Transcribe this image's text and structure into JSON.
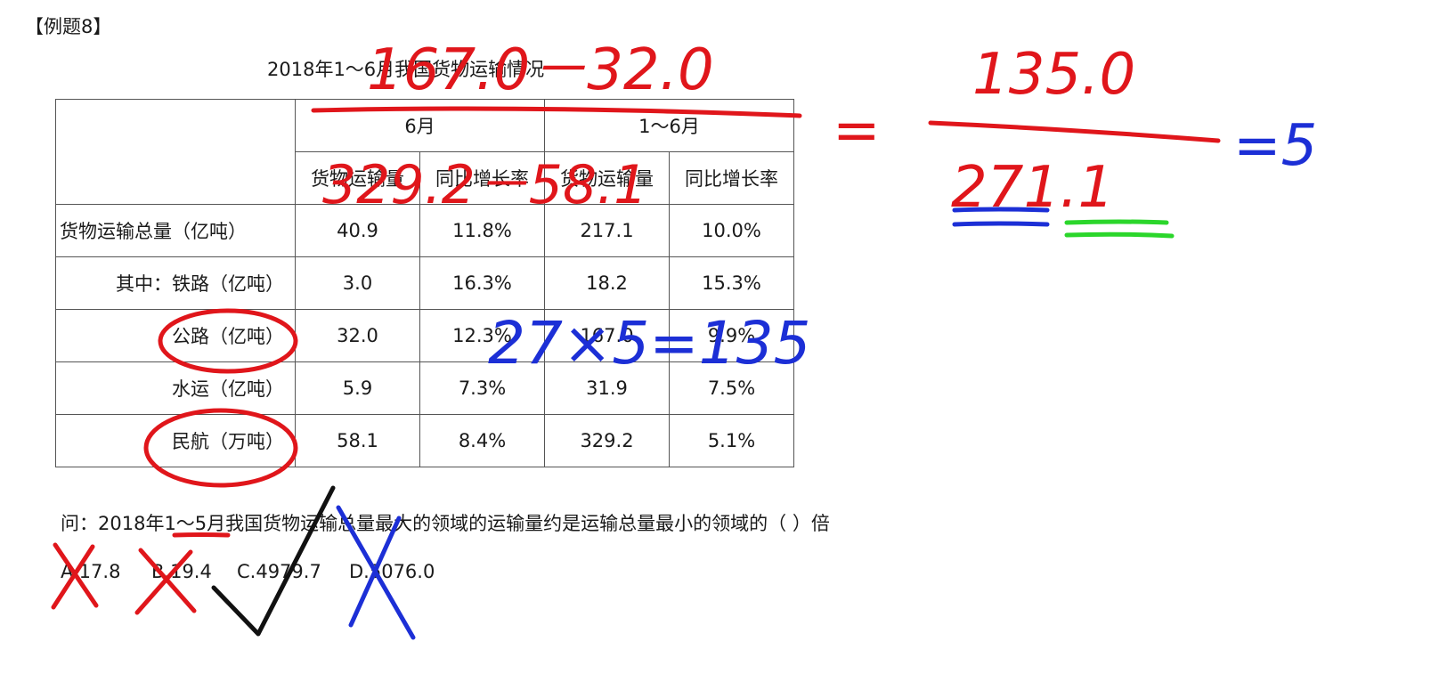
{
  "heading": "【例题8】",
  "table": {
    "title": "2018年1～6月我国货物运输情况",
    "groups": [
      "6月",
      "1～6月"
    ],
    "subheaders": [
      "货物运输量",
      "同比增长率",
      "货物运输量",
      "同比增长率"
    ],
    "rows": [
      {
        "label": "货物运输总量（亿吨）",
        "c1": "40.9",
        "c2": "11.8%",
        "c3": "217.1",
        "c4": "10.0%"
      },
      {
        "label": "其中：铁路（亿吨）",
        "c1": "3.0",
        "c2": "16.3%",
        "c3": "18.2",
        "c4": "15.3%"
      },
      {
        "label": "公路（亿吨）",
        "c1": "32.0",
        "c2": "12.3%",
        "c3": "167.0",
        "c4": "9.9%"
      },
      {
        "label": "水运（亿吨）",
        "c1": "5.9",
        "c2": "7.3%",
        "c3": "31.9",
        "c4": "7.5%"
      },
      {
        "label": "民航（万吨）",
        "c1": "58.1",
        "c2": "8.4%",
        "c3": "329.2",
        "c4": "5.1%"
      }
    ]
  },
  "question": "问：2018年1～5月我国货物运输总量最大的领域的运输量约是运输总量最小的领域的（  ）倍",
  "options": [
    "A.17.8",
    "B.19.4",
    "C.4979.7",
    "D.5076.0"
  ],
  "annotations": {
    "numerator_top": "167.0－32.0",
    "denominator_top": "329.2－58.1",
    "equals": "=",
    "frac_num": "135.0",
    "frac_den": "271.1",
    "result": "=5",
    "side_calc": "27×5=135"
  },
  "colors": {
    "red": "#e0161b",
    "blue": "#1c2fd6",
    "green": "#2bd62b",
    "black": "#111111"
  }
}
